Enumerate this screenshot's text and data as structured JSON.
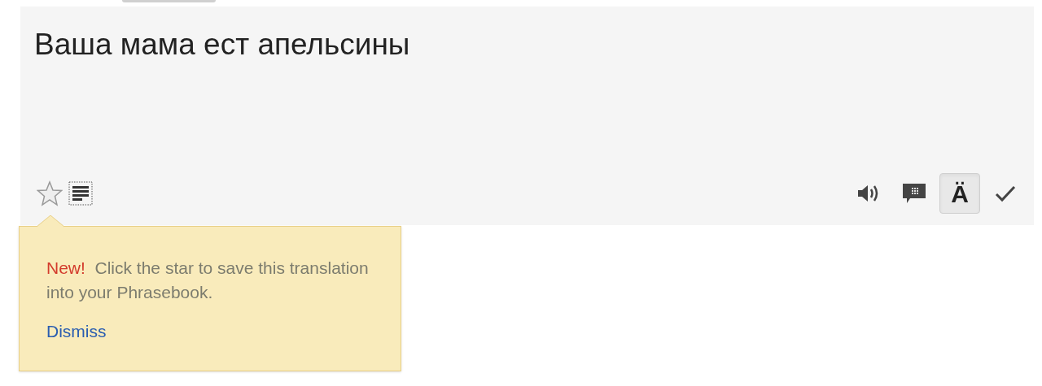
{
  "translation": {
    "text": "Ваша мама ест апельсины"
  },
  "toolbar": {
    "starred": false,
    "right_buttons": [
      {
        "kind": "speaker",
        "selected": false
      },
      {
        "kind": "feedback",
        "selected": false
      },
      {
        "kind": "romanize",
        "label": "Ä",
        "selected": true
      },
      {
        "kind": "check",
        "selected": false
      }
    ]
  },
  "tooltip": {
    "badge": "New!",
    "message": "Click the star to save this translation into your Phrasebook.",
    "link": "Dismiss"
  }
}
